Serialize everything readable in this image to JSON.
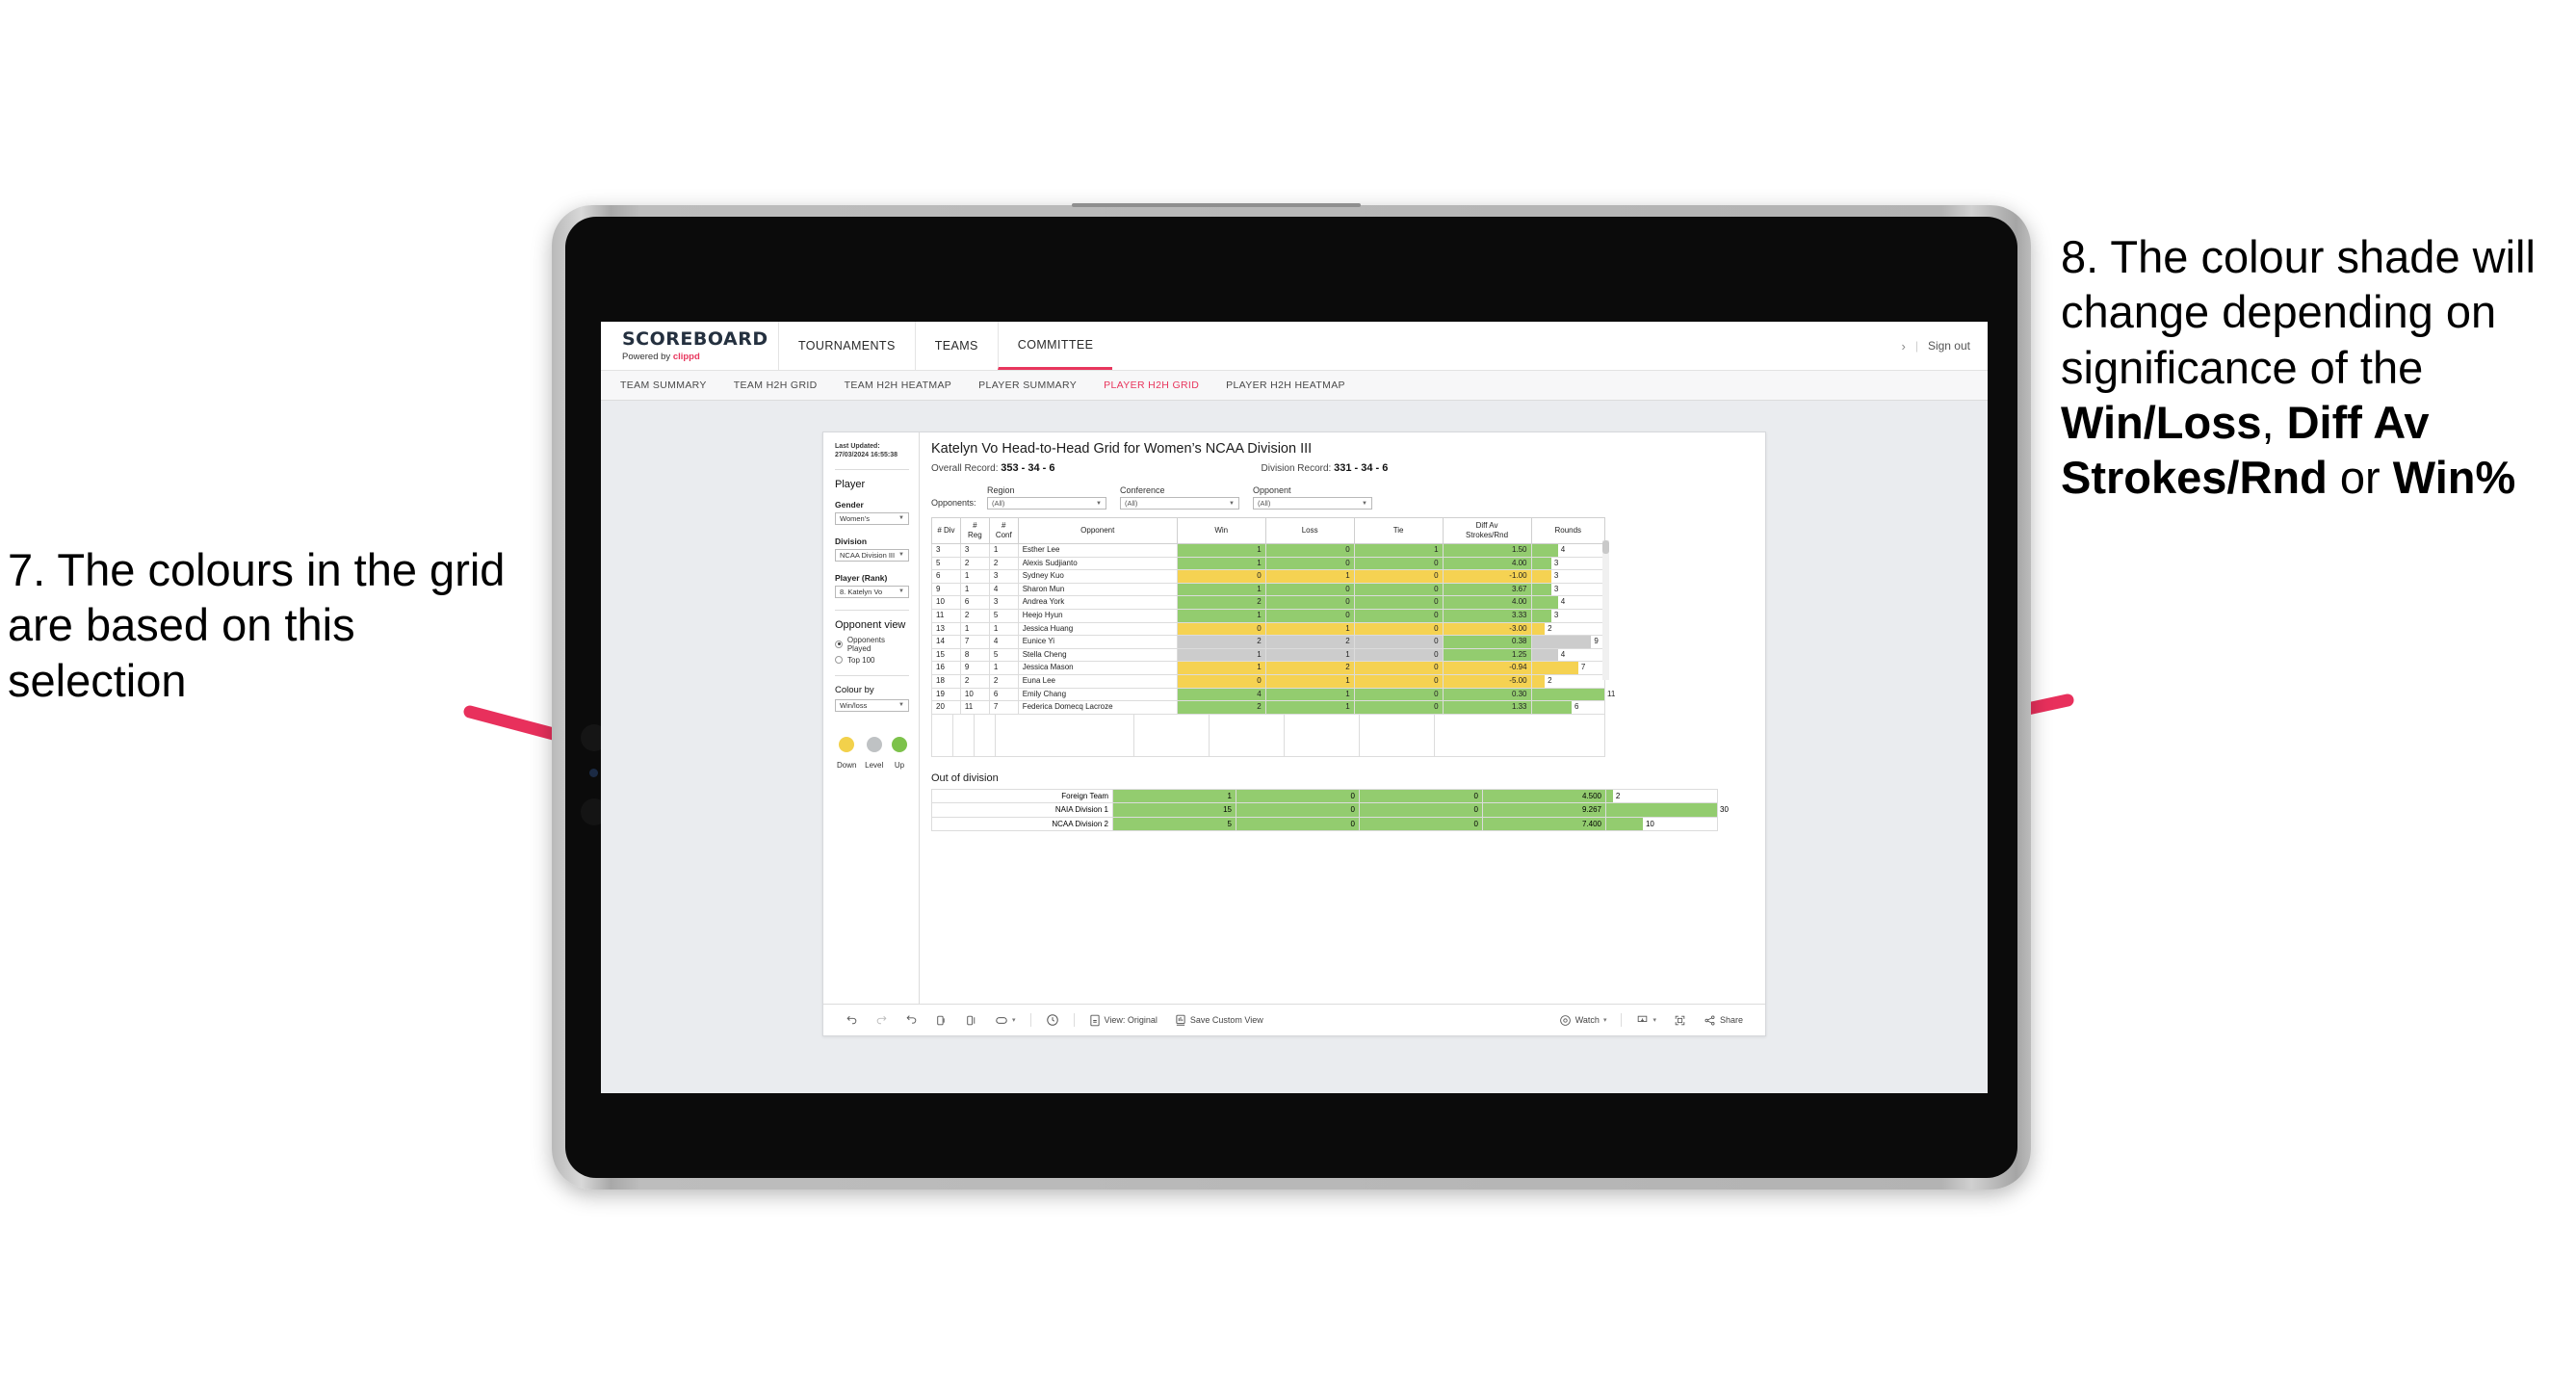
{
  "annotations": {
    "left": {
      "id": "annotation-7",
      "text": "7. The colours in the grid are based on this selection"
    },
    "right": {
      "id": "annotation-8",
      "lead": "8. The colour shade will change depending on significance of the ",
      "bold1": "Win/Loss",
      "mid1": ", ",
      "bold2": "Diff Av Strokes/Rnd",
      "mid2": " or ",
      "bold3": "Win%"
    },
    "arrow_color": "#E8305C"
  },
  "app": {
    "brand": {
      "title": "SCOREBOARD",
      "powered_prefix": "Powered by ",
      "powered_brand": "clippd"
    },
    "nav": [
      {
        "label": "TOURNAMENTS",
        "active": false
      },
      {
        "label": "TEAMS",
        "active": false
      },
      {
        "label": "COMMITTEE",
        "active": true
      }
    ],
    "header_right": {
      "chevron": "›",
      "divider": "|",
      "sign_out": "Sign out"
    },
    "subnav": [
      {
        "label": "TEAM SUMMARY",
        "active": false
      },
      {
        "label": "TEAM H2H GRID",
        "active": false
      },
      {
        "label": "TEAM H2H HEATMAP",
        "active": false
      },
      {
        "label": "PLAYER SUMMARY",
        "active": false
      },
      {
        "label": "PLAYER H2H GRID",
        "active": true
      },
      {
        "label": "PLAYER H2H HEATMAP",
        "active": false
      }
    ]
  },
  "sidebar": {
    "last_updated": "Last Updated: 27/03/2024 16:55:38",
    "player_heading": "Player",
    "gender_label": "Gender",
    "gender_value": "Women’s",
    "division_label": "Division",
    "division_value": "NCAA Division III",
    "player_rank_label": "Player (Rank)",
    "player_rank_value": "8. Katelyn Vo",
    "opponent_view_heading": "Opponent view",
    "opponent_options": [
      {
        "label": "Opponents Played",
        "selected": true
      },
      {
        "label": "Top 100",
        "selected": false
      }
    ],
    "colour_by_label": "Colour by",
    "colour_by_value": "Win/loss",
    "legend": [
      {
        "label": "Down",
        "color": "#F2D14B"
      },
      {
        "label": "Level",
        "color": "#BFC2C4"
      },
      {
        "label": "Up",
        "color": "#7DC24B"
      }
    ]
  },
  "main": {
    "title": "Katelyn Vo Head-to-Head Grid for Women’s NCAA Division III",
    "overall_record_label": "Overall Record: ",
    "overall_record_value": "353 -  34 - 6",
    "division_record_label": "Division Record: ",
    "division_record_value": "331 -  34 - 6",
    "opponents_label": "Opponents:",
    "filters": [
      {
        "label": "Region",
        "value": "(All)"
      },
      {
        "label": "Conference",
        "value": "(All)"
      },
      {
        "label": "Opponent",
        "value": "(All)"
      }
    ],
    "columns": [
      "# Div",
      "# Reg",
      "# Conf",
      "Opponent",
      "Win",
      "Loss",
      "Tie",
      "Diff Av Strokes/Rnd",
      "Rounds"
    ],
    "col_div": "# Div",
    "col_reg": "# Reg",
    "col_conf": "# Conf",
    "col_opponent": "Opponent",
    "col_win": "Win",
    "col_loss": "Loss",
    "col_tie": "Tie",
    "col_diff": "Diff Av Strokes/Rnd",
    "col_rounds": "Rounds",
    "out_of_division_title": "Out of division"
  },
  "chart_data": {
    "type": "table",
    "title": "Katelyn Vo Head-to-Head Grid for Women’s NCAA Division III",
    "colour_by": "Win/loss",
    "colors": {
      "up": "#93CC6F",
      "down": "#F5D252",
      "level": "#CCCCCC",
      "bar": "#93CC6F"
    },
    "columns": [
      "#Div",
      "#Reg",
      "#Conf",
      "Opponent",
      "Win",
      "Loss",
      "Tie",
      "Diff Av Strokes/Rnd",
      "Rounds"
    ],
    "rows": [
      {
        "div": "3",
        "reg": "3",
        "conf": "1",
        "opponent": "Esther Lee",
        "win": "1",
        "loss": "0",
        "tie": "1",
        "diff": "1.50",
        "rounds": "4",
        "rounds_pct": 36,
        "shade": "up"
      },
      {
        "div": "5",
        "reg": "2",
        "conf": "2",
        "opponent": "Alexis Sudjianto",
        "win": "1",
        "loss": "0",
        "tie": "0",
        "diff": "4.00",
        "rounds": "3",
        "rounds_pct": 27,
        "shade": "up"
      },
      {
        "div": "6",
        "reg": "1",
        "conf": "3",
        "opponent": "Sydney Kuo",
        "win": "0",
        "loss": "1",
        "tie": "0",
        "diff": "-1.00",
        "rounds": "3",
        "rounds_pct": 27,
        "shade": "down"
      },
      {
        "div": "9",
        "reg": "1",
        "conf": "4",
        "opponent": "Sharon Mun",
        "win": "1",
        "loss": "0",
        "tie": "0",
        "diff": "3.67",
        "rounds": "3",
        "rounds_pct": 27,
        "shade": "up"
      },
      {
        "div": "10",
        "reg": "6",
        "conf": "3",
        "opponent": "Andrea York",
        "win": "2",
        "loss": "0",
        "tie": "0",
        "diff": "4.00",
        "rounds": "4",
        "rounds_pct": 36,
        "shade": "up"
      },
      {
        "div": "11",
        "reg": "2",
        "conf": "5",
        "opponent": "Heejo Hyun",
        "win": "1",
        "loss": "0",
        "tie": "0",
        "diff": "3.33",
        "rounds": "3",
        "rounds_pct": 27,
        "shade": "up"
      },
      {
        "div": "13",
        "reg": "1",
        "conf": "1",
        "opponent": "Jessica Huang",
        "win": "0",
        "loss": "1",
        "tie": "0",
        "diff": "-3.00",
        "rounds": "2",
        "rounds_pct": 18,
        "shade": "down"
      },
      {
        "div": "14",
        "reg": "7",
        "conf": "4",
        "opponent": "Eunice Yi",
        "win": "2",
        "loss": "2",
        "tie": "0",
        "diff": "0.38",
        "rounds": "9",
        "rounds_pct": 82,
        "shade": "level",
        "diff_shade": "up"
      },
      {
        "div": "15",
        "reg": "8",
        "conf": "5",
        "opponent": "Stella Cheng",
        "win": "1",
        "loss": "1",
        "tie": "0",
        "diff": "1.25",
        "rounds": "4",
        "rounds_pct": 36,
        "shade": "level",
        "diff_shade": "up"
      },
      {
        "div": "16",
        "reg": "9",
        "conf": "1",
        "opponent": "Jessica Mason",
        "win": "1",
        "loss": "2",
        "tie": "0",
        "diff": "-0.94",
        "rounds": "7",
        "rounds_pct": 64,
        "shade": "down"
      },
      {
        "div": "18",
        "reg": "2",
        "conf": "2",
        "opponent": "Euna Lee",
        "win": "0",
        "loss": "1",
        "tie": "0",
        "diff": "-5.00",
        "rounds": "2",
        "rounds_pct": 18,
        "shade": "down"
      },
      {
        "div": "19",
        "reg": "10",
        "conf": "6",
        "opponent": "Emily Chang",
        "win": "4",
        "loss": "1",
        "tie": "0",
        "diff": "0.30",
        "rounds": "11",
        "rounds_pct": 100,
        "shade": "up"
      },
      {
        "div": "20",
        "reg": "11",
        "conf": "7",
        "opponent": "Federica Domecq Lacroze",
        "win": "2",
        "loss": "1",
        "tie": "0",
        "diff": "1.33",
        "rounds": "6",
        "rounds_pct": 55,
        "shade": "up"
      }
    ],
    "out_of_division": {
      "title": "Out of division",
      "rows": [
        {
          "name": "Foreign Team",
          "win": "1",
          "loss": "0",
          "tie": "0",
          "diff": "4.500",
          "rounds": "2",
          "rounds_pct": 6,
          "shade": "up"
        },
        {
          "name": "NAIA Division 1",
          "win": "15",
          "loss": "0",
          "tie": "0",
          "diff": "9.267",
          "rounds": "30",
          "rounds_pct": 100,
          "shade": "up"
        },
        {
          "name": "NCAA Division 2",
          "win": "5",
          "loss": "0",
          "tie": "0",
          "diff": "7.400",
          "rounds": "10",
          "rounds_pct": 33,
          "shade": "up"
        }
      ]
    }
  },
  "toolbar": {
    "undo": "undo-icon",
    "redo": "redo-icon",
    "revert": "revert-icon",
    "refresh": "refresh-icon",
    "pause": "pause-icon",
    "shape": "shape-icon",
    "shape_caret": "▾",
    "clock": "clock-icon",
    "view_label": "View: Original",
    "save_label": "Save Custom View",
    "watch_label": "Watch",
    "watch_caret": "▾",
    "download_caret": "▾",
    "fullscreen": "fullscreen-icon",
    "share_label": "Share"
  }
}
